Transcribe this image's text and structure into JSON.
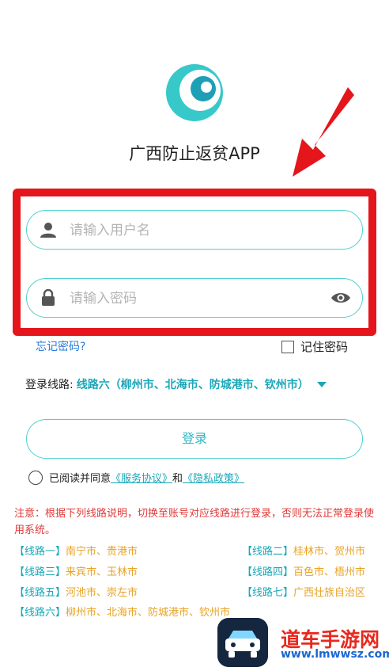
{
  "app": {
    "title": "广西防止返贫APP"
  },
  "login": {
    "username_placeholder": "请输入用户名",
    "password_placeholder": "请输入密码",
    "forgot_label": "忘记密码?",
    "remember_label": "记住密码",
    "route_label": "登录线路:",
    "route_value": "线路六（柳州市、北海市、防城港市、钦州市）",
    "submit_label": "登录"
  },
  "agreement": {
    "prefix": "已阅读并同意",
    "service_link": "《服务协议》",
    "and": "和",
    "privacy_link": "《隐私政策》"
  },
  "notice": {
    "text": "注意：根据下列线路说明，切换至账号对应线路进行登录，否则无法正常登录使用系统。"
  },
  "routes": [
    {
      "tag": "【线路一】",
      "cities": "南宁市、贵港市"
    },
    {
      "tag": "【线路二】",
      "cities": "桂林市、贺州市"
    },
    {
      "tag": "【线路三】",
      "cities": "来宾市、玉林市"
    },
    {
      "tag": "【线路四】",
      "cities": "百色市、梧州市"
    },
    {
      "tag": "【线路五】",
      "cities": "河池市、崇左市"
    },
    {
      "tag": "【线路七】",
      "cities": "广西壮族自治区"
    },
    {
      "tag": "【线路六】",
      "cities": "柳州市、北海市、防城港市、钦州市"
    }
  ],
  "watermark": {
    "name": "道车手游网",
    "url": "www.lmwwsz.com"
  },
  "colors": {
    "accent": "#4fd0cf",
    "link": "#2b7bd6",
    "highlight": "#e5151c",
    "warning": "#e03a3a",
    "city": "#e8a326"
  }
}
